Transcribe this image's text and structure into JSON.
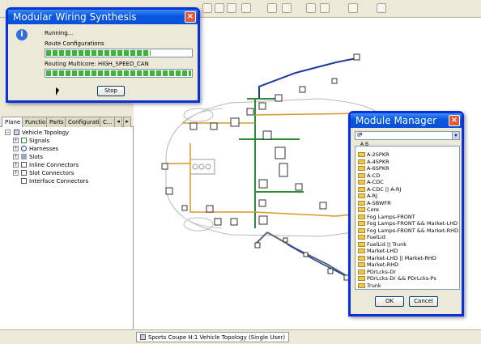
{
  "toolbar": {
    "icons": [
      "magnify-icon",
      "component-icon",
      "pointer-icon",
      "grid-icon",
      "ruler-icon",
      "wire-icon",
      "settings-icon",
      "zoom-icon",
      "text-icon",
      "harness-icon"
    ]
  },
  "synthesis_dialog": {
    "title": "Modular Wiring Synthesis",
    "status": "Running...",
    "task1_label": "Route Configurations",
    "task1_progress": 0.72,
    "task2_label": "Routing Multicore: HIGH_SPEED_CAN",
    "task2_progress": 1.0,
    "stop_label": "Stop"
  },
  "tree_panel": {
    "tabs": [
      "Plane",
      "Function",
      "Parts",
      "Configuration",
      "C..."
    ],
    "nav_left": "◂",
    "nav_right": "▸",
    "root": "Vehicle Topology",
    "items": [
      "Signals",
      "Harnesses",
      "Slots",
      "Inline Connectors",
      "Slot Connectors",
      "Interface Connectors"
    ]
  },
  "module_manager": {
    "title": "Module Manager",
    "filter_value": "IP",
    "sort_label": "A B",
    "items": [
      "A-2SPKR",
      "A-4SPKR",
      "A-6SPKR",
      "A-CD",
      "A-CDC",
      "A-CDC || A-RJ",
      "A-RJ",
      "A-SBWFR",
      "Core",
      "Fog Lamps-FRONT",
      "Fog Lamps-FRONT && Market-LHD",
      "Fog Lamps-FRONT && Market-RHD",
      "FuelLid",
      "FuelLid || Trunk",
      "Market-LHD",
      "Market-LHD || Market-RHD",
      "Market-RHD",
      "PDrLcks-Dr",
      "PDrLcks-Dr && PDrLcks-Ps",
      "Trunk"
    ],
    "ok_label": "OK",
    "cancel_label": "Cancel"
  },
  "status_bar": {
    "tab_label": "Sports Coupe H:1 Vehicle Topology (Single User)"
  },
  "colors": {
    "harness_green": "#2e8b3a",
    "harness_blue": "#1f3a9c",
    "harness_orange": "#d79a2a",
    "harness_gray": "#586878",
    "xp_title": "#0a58e0"
  }
}
